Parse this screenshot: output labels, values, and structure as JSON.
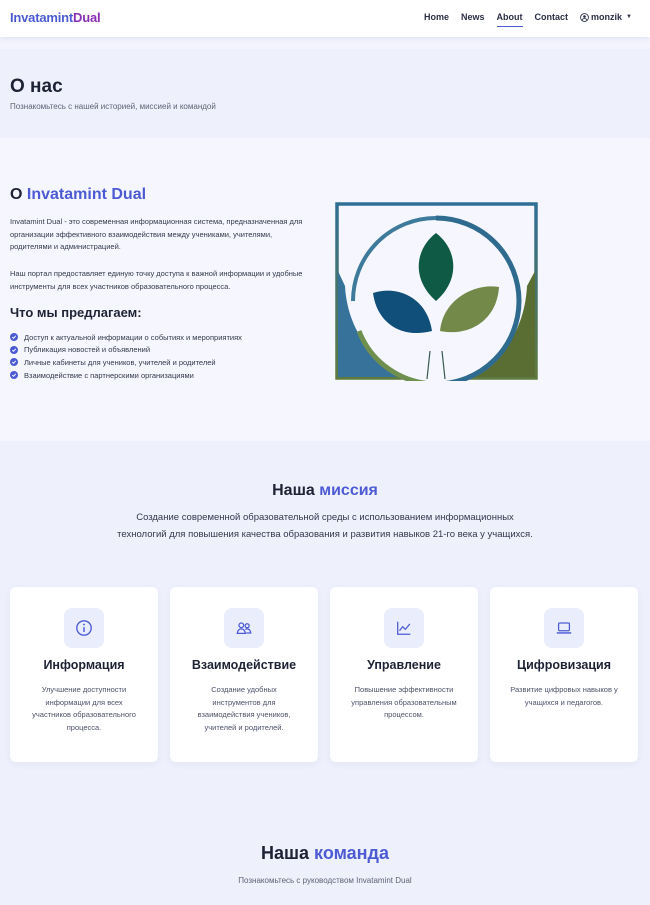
{
  "navbar": {
    "brand_part1": "Invatamint",
    "brand_part2": "Dual",
    "links": [
      "Home",
      "News",
      "About",
      "Contact"
    ],
    "active": "About",
    "user": "monzik"
  },
  "hero": {
    "title": "О нас",
    "subtitle": "Познакомьтесь с нашей историей, миссией и командой"
  },
  "about": {
    "heading_prefix": "О",
    "heading_accent": "Invatamint Dual",
    "paragraph1": "Invatamint Dual - это современная информационная система, предназначенная для организации эффективного взаимодействия между учениками, учителями, родителями и администрацией.",
    "paragraph2": "Наш портал предоставляет единую точку доступа к важной информации и удобные инструменты для всех участников образовательного процесса.",
    "offer_heading": "Что мы предлагаем:",
    "offers": [
      "Доступ к актуальной информации о событиях и мероприятиях",
      "Публикация новостей и объявлений",
      "Личные кабинеты для учеников, учителей и родителей",
      "Взаимодействие с партнерскими организациями"
    ]
  },
  "mission": {
    "heading_prefix": "Наша",
    "heading_accent": "миссия",
    "lead": "Создание современной образовательной среды с использованием информационных технологий для повышения качества образования и развития навыков 21-го века у учащихся.",
    "cards": [
      {
        "title": "Информация",
        "icon": "info-icon",
        "desc": "Улучшение доступности информации для всех участников образовательного процесса."
      },
      {
        "title": "Взаимодействие",
        "icon": "people-icon",
        "desc": "Создание удобных инструментов для взаимодействия учеников, учителей и родителей."
      },
      {
        "title": "Управление",
        "icon": "chart-icon",
        "desc": "Повышение эффективности управления образовательным процессом."
      },
      {
        "title": "Цифровизация",
        "icon": "laptop-icon",
        "desc": "Развитие цифровых навыков у учащихся и педагогов."
      }
    ]
  },
  "team": {
    "heading_prefix": "Наша",
    "heading_accent": "команда",
    "subtitle": "Познакомьтесь с руководством Invatamint Dual"
  },
  "colors": {
    "accent": "#4c5bd4",
    "brand_secondary": "#8a2db5",
    "leaf_dark_green": "#0e5a45",
    "leaf_blue": "#0f4f7a",
    "leaf_olive": "#72894a"
  }
}
